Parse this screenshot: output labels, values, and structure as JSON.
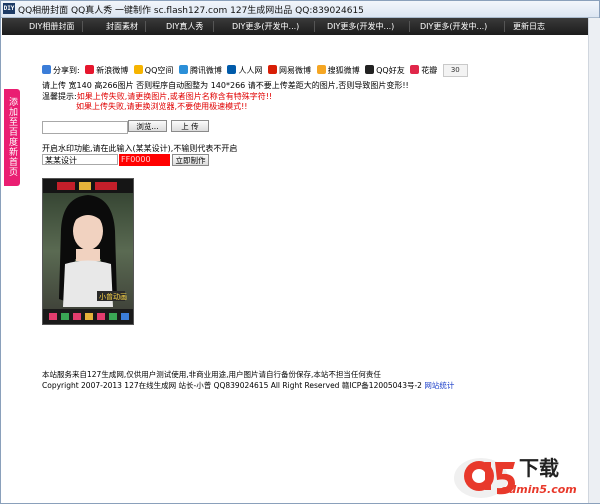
{
  "window": {
    "title": "QQ相册封面 QQ真人秀 一键制作 sc.flash127.com 127生成网出品 QQ:839024615",
    "icon_text": "DIY"
  },
  "nav": {
    "items": [
      "DIY相册封面",
      "封面素材",
      "DIY真人秀",
      "DIY更多(开发中...)",
      "DIY更多(开发中...)",
      "DIY更多(开发中...)",
      "更新日志"
    ]
  },
  "sidebar": {
    "label": "添加至百度新首页"
  },
  "share": {
    "label": "分享到:",
    "items": [
      "新浪微博",
      "QQ空间",
      "腾讯微博",
      "人人网",
      "网易微博",
      "搜狐微博",
      "QQ好友",
      "花瓣"
    ],
    "count": "30"
  },
  "instructions": {
    "line1": "请上传 宽140 高266图片 否则程序自动图整为 140*266 请不要上传差距大的图片,否则导致图片变形!!",
    "tip_label": "温馨提示:",
    "tip1": "如果上传失败,请更换图片,或者图片名称含有特殊字符!!",
    "tip2": "如果上传失败,请更换浏览器,不要使用极速模式!!"
  },
  "upload": {
    "browse_label": "浏览...",
    "upload_label": "上 传"
  },
  "watermark_opt": {
    "prompt": "开启水印功能,请在此输入(某某设计),不输则代表不开启",
    "text_value": "某某设计",
    "color_value": "FF0000",
    "make_label": "立即制作"
  },
  "preview": {
    "caption": "小曾动画"
  },
  "footer": {
    "disclaimer": "本站服务来自127生成网,仅供用户测试使用,非商业用途,用户图片请自行备份保存,本站不担当任何责任",
    "copyright": "Copyright 2007-2013 127在线生成网 站长-小曾  QQ839024615 All Right Reserved 赣ICP备12005043号-2",
    "stats_link": "网站统计"
  },
  "brand": {
    "logo": "a5",
    "tagline": "下载",
    "domain": "admin5.com"
  },
  "colors": {
    "nav_bg": "#2a2a2a",
    "accent_pink": "#ea1e72",
    "warning_red": "#e00000",
    "link_blue": "#1a3ec9"
  }
}
